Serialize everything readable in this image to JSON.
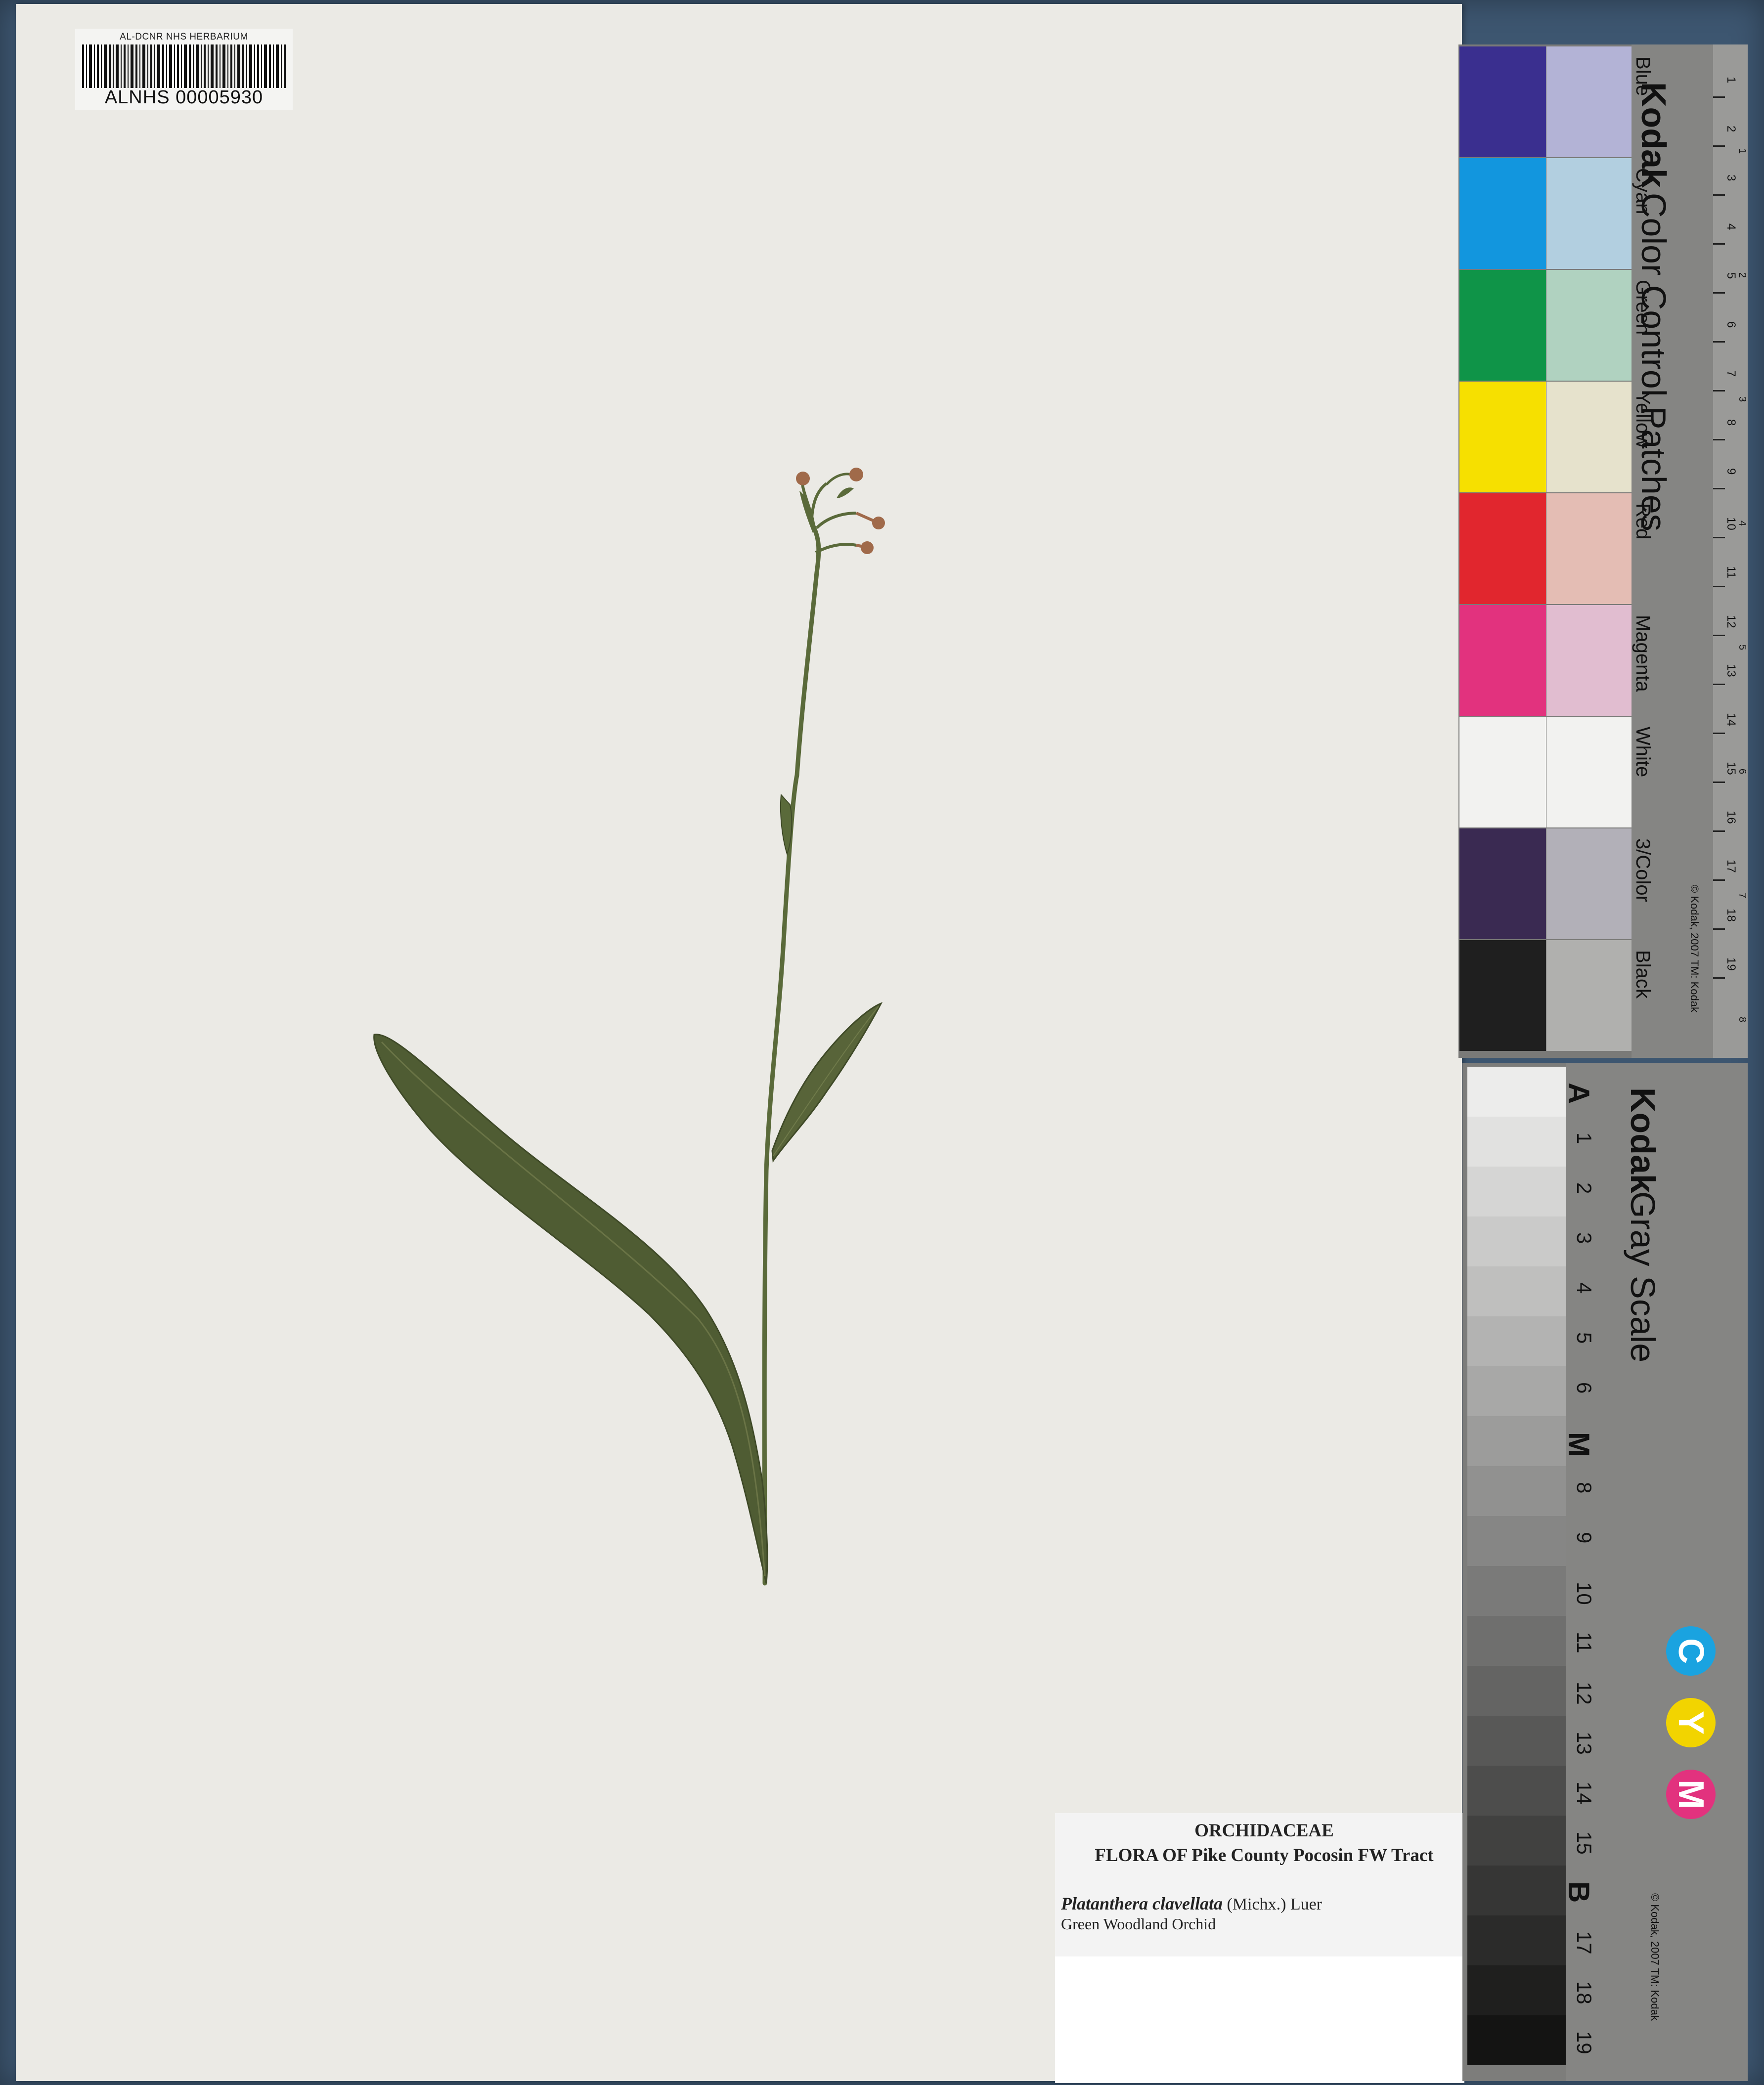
{
  "barcode_label": {
    "institution": "AL-DCNR NHS HERBARIUM",
    "catalog_number": "ALNHS 00005930"
  },
  "herbarium_label": {
    "family": "ORCHIDACEAE",
    "flora": "FLORA OF Pike County Pocosin FW Tract",
    "scientific_name": "Platanthera clavellata",
    "authority": " (Michx.) Luer",
    "common_name": "Green Woodland Orchid"
  },
  "color_card": {
    "brand": "Kodak",
    "title": "Color Control Patches",
    "copyright": "© Kodak, 2007 TM: Kodak",
    "ruler_units": [
      "cm",
      "inches"
    ],
    "patches": [
      {
        "name": "Blue",
        "strong": "#3a2f8f",
        "light": "#b3b3d6"
      },
      {
        "name": "Cyan",
        "strong": "#1296de",
        "light": "#b2cfe0"
      },
      {
        "name": "Green",
        "strong": "#0f9448",
        "light": "#b0d2c0"
      },
      {
        "name": "Yellow",
        "strong": "#f6e000",
        "light": "#e6e2cc"
      },
      {
        "name": "Red",
        "strong": "#e1262e",
        "light": "#e4bdb4"
      },
      {
        "name": "Magenta",
        "strong": "#e2327e",
        "light": "#e1bdd0"
      },
      {
        "name": "White",
        "strong": "#f2f2f0",
        "light": "#f2f2f0"
      },
      {
        "name": "3/Color",
        "strong": "#3a2a52",
        "light": "#b2b0b8"
      },
      {
        "name": "Black",
        "strong": "#1f1f1f",
        "light": "#b0b0ae"
      }
    ],
    "ruler_cm": [
      "1",
      "2",
      "3",
      "4",
      "5",
      "6",
      "7",
      "8",
      "9",
      "10",
      "11",
      "12",
      "13",
      "14",
      "15",
      "16",
      "17",
      "18",
      "19"
    ],
    "ruler_in": [
      "1",
      "2",
      "3",
      "4",
      "5",
      "6",
      "7",
      "8"
    ]
  },
  "gray_card": {
    "brand": "Kodak",
    "title": "Gray Scale",
    "copyright": "© Kodak, 2007 TM: Kodak",
    "steps": [
      "A",
      "1",
      "2",
      "3",
      "4",
      "5",
      "6",
      "M",
      "8",
      "9",
      "10",
      "11",
      "12",
      "13",
      "14",
      "15",
      "B",
      "17",
      "18",
      "19"
    ],
    "cmy": [
      {
        "letter": "C",
        "color": "#1aa3e0"
      },
      {
        "letter": "Y",
        "color": "#f2d400"
      },
      {
        "letter": "M",
        "color": "#e2327e"
      }
    ]
  },
  "colors": {
    "sheet": "#ebeae5",
    "stem": "#5a6a3a",
    "leaf": "#4f5c33",
    "flower": "#a06a4a"
  }
}
